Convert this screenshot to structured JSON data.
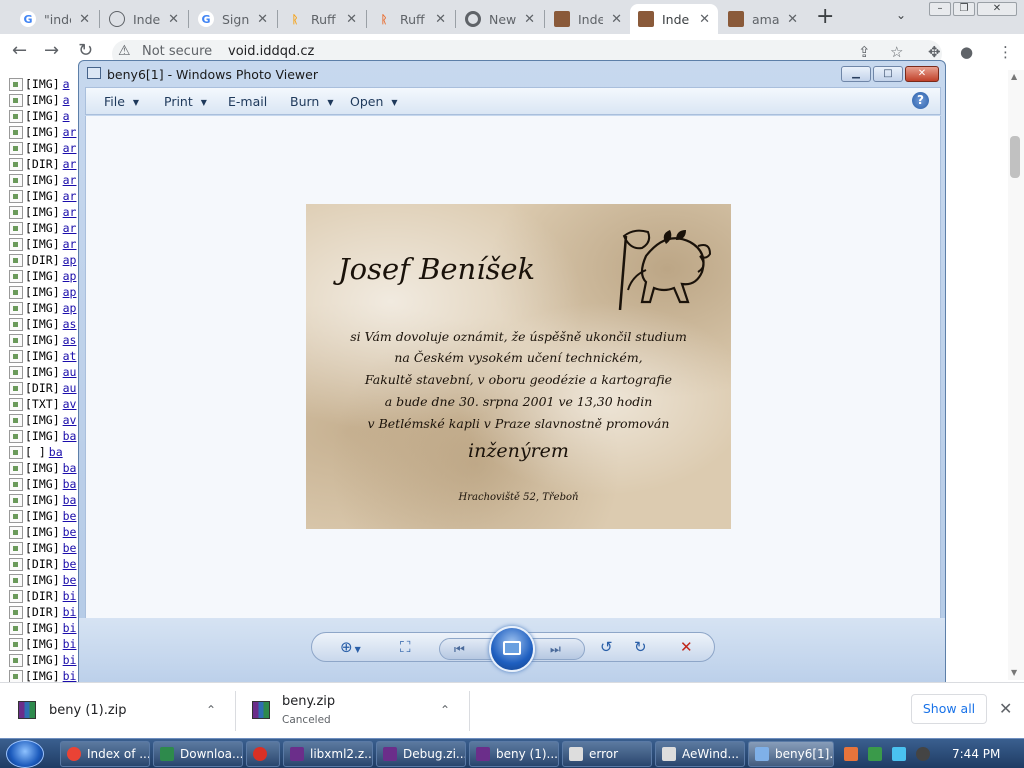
{
  "browser": {
    "tabs": [
      {
        "label": "\"inde",
        "icon": "google-icon"
      },
      {
        "label": "Inde",
        "icon": "globe-icon"
      },
      {
        "label": "Sign",
        "icon": "google-icon"
      },
      {
        "label": "Ruff",
        "icon": "ruffle-icon"
      },
      {
        "label": "Ruff",
        "icon": "ruffle-icon"
      },
      {
        "label": "New",
        "icon": "chrome-icon"
      },
      {
        "label": "Inde",
        "icon": "portrait-icon"
      },
      {
        "label": "Inde",
        "icon": "portrait-icon"
      },
      {
        "label": "ama",
        "icon": "portrait-icon"
      }
    ],
    "omnibox": {
      "security": "Not secure",
      "url": "void.iddqd.cz"
    }
  },
  "listing": {
    "rows": [
      {
        "tag": "[IMG]",
        "link": "a"
      },
      {
        "tag": "[IMG]",
        "link": "a"
      },
      {
        "tag": "[IMG]",
        "link": "a"
      },
      {
        "tag": "[IMG]",
        "link": "ar"
      },
      {
        "tag": "[IMG]",
        "link": "ar"
      },
      {
        "tag": "[DIR]",
        "link": "ar"
      },
      {
        "tag": "[IMG]",
        "link": "ar"
      },
      {
        "tag": "[IMG]",
        "link": "ar"
      },
      {
        "tag": "[IMG]",
        "link": "ar"
      },
      {
        "tag": "[IMG]",
        "link": "ar"
      },
      {
        "tag": "[IMG]",
        "link": "ar"
      },
      {
        "tag": "[DIR]",
        "link": "ap"
      },
      {
        "tag": "[IMG]",
        "link": "ap"
      },
      {
        "tag": "[IMG]",
        "link": "ap"
      },
      {
        "tag": "[IMG]",
        "link": "ap"
      },
      {
        "tag": "[IMG]",
        "link": "as"
      },
      {
        "tag": "[IMG]",
        "link": "as"
      },
      {
        "tag": "[IMG]",
        "link": "at"
      },
      {
        "tag": "[IMG]",
        "link": "au"
      },
      {
        "tag": "[DIR]",
        "link": "au"
      },
      {
        "tag": "[TXT]",
        "link": "av"
      },
      {
        "tag": "[IMG]",
        "link": "av"
      },
      {
        "tag": "[IMG]",
        "link": "ba"
      },
      {
        "tag": "[   ]",
        "link": "ba"
      },
      {
        "tag": "[IMG]",
        "link": "ba"
      },
      {
        "tag": "[IMG]",
        "link": "ba"
      },
      {
        "tag": "[IMG]",
        "link": "ba"
      },
      {
        "tag": "[IMG]",
        "link": "be"
      },
      {
        "tag": "[IMG]",
        "link": "be"
      },
      {
        "tag": "[IMG]",
        "link": "be"
      },
      {
        "tag": "[DIR]",
        "link": "be"
      },
      {
        "tag": "[IMG]",
        "link": "be"
      },
      {
        "tag": "[DIR]",
        "link": "bi"
      },
      {
        "tag": "[DIR]",
        "link": "bi"
      },
      {
        "tag": "[IMG]",
        "link": "bi"
      },
      {
        "tag": "[IMG]",
        "link": "bi"
      },
      {
        "tag": "[IMG]",
        "link": "bi"
      },
      {
        "tag": "[IMG]",
        "link": "bi"
      }
    ]
  },
  "photo_viewer": {
    "title": "beny6[1] - Windows Photo Viewer",
    "menu": {
      "file": "File",
      "print": "Print",
      "email": "E-mail",
      "burn": "Burn",
      "open": "Open"
    },
    "help": "?",
    "card": {
      "name": "Josef Beníšek",
      "lines": [
        "si Vám dovoluje oznámit, že úspěšně ukončil studium",
        "na Českém vysokém učení technickém,",
        "Fakultě stavební, v oboru geodézie a kartografie",
        "a bude dne 30. srpna 2001 ve 13,30 hodin",
        "v Betlémské kapli v Praze slavnostně promován"
      ],
      "title_line": "inženýrem",
      "address": "Hrachoviště 52, Třeboň"
    }
  },
  "downloads": {
    "items": [
      {
        "name": "beny (1).zip",
        "status": ""
      },
      {
        "name": "beny.zip",
        "status": "Canceled"
      }
    ],
    "show_all": "Show all"
  },
  "taskbar": {
    "items": [
      {
        "label": "Index of ...",
        "color": "#ea4335"
      },
      {
        "label": "Downloa...",
        "color": "#2e8a4c"
      },
      {
        "label": "",
        "color": "#d93025"
      },
      {
        "label": "libxml2.z...",
        "color": "#6b2e8a"
      },
      {
        "label": "Debug.zi...",
        "color": "#6b2e8a"
      },
      {
        "label": "beny (1)....",
        "color": "#6b2e8a"
      },
      {
        "label": "error",
        "color": "#dddddd"
      },
      {
        "label": "AeWind...",
        "color": "#dddddd"
      },
      {
        "label": "beny6[1]...",
        "color": "#7fb0e8"
      }
    ],
    "clock": "7:44 PM"
  },
  "colors": {
    "link": "#1a0dab",
    "viewer_frame": "#b4cae6",
    "taskbar": "#1f3c64",
    "accent": "#1a73e8"
  }
}
